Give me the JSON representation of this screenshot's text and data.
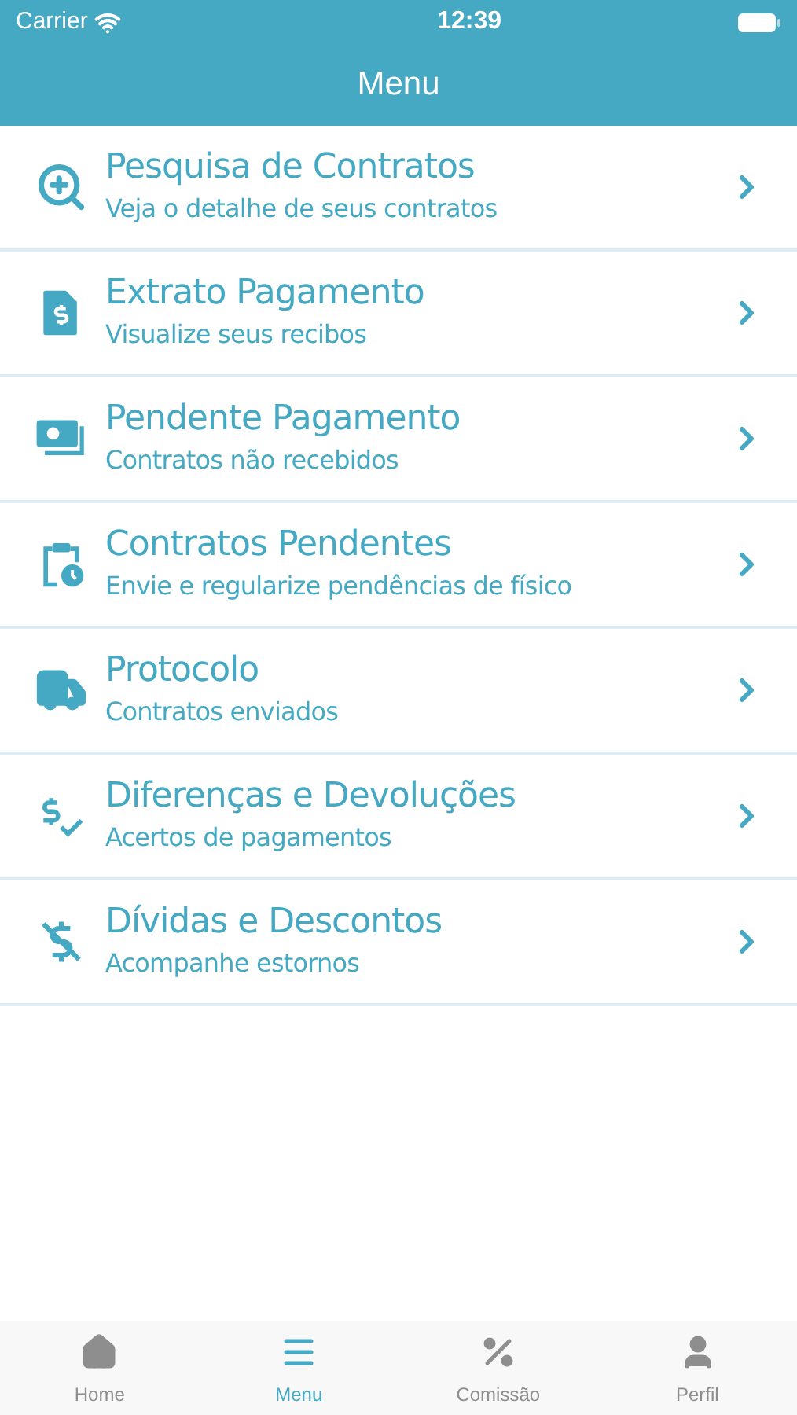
{
  "status_bar": {
    "carrier": "Carrier",
    "time": "12:39"
  },
  "header": {
    "title": "Menu"
  },
  "menu_items": [
    {
      "title": "Pesquisa de Contratos",
      "subtitle": "Veja o detalhe de seus contratos"
    },
    {
      "title": "Extrato Pagamento",
      "subtitle": "Visualize seus recibos"
    },
    {
      "title": "Pendente Pagamento",
      "subtitle": "Contratos não recebidos"
    },
    {
      "title": "Contratos Pendentes",
      "subtitle": "Envie e regularize pendências de físico"
    },
    {
      "title": "Protocolo",
      "subtitle": "Contratos enviados"
    },
    {
      "title": "Diferenças e Devoluções",
      "subtitle": "Acertos de pagamentos"
    },
    {
      "title": "Dívidas e Descontos",
      "subtitle": "Acompanhe estornos"
    }
  ],
  "tab_bar": [
    {
      "label": "Home",
      "selected": false
    },
    {
      "label": "Menu",
      "selected": true
    },
    {
      "label": "Comissão",
      "selected": false
    },
    {
      "label": "Perfil",
      "selected": false
    }
  ]
}
